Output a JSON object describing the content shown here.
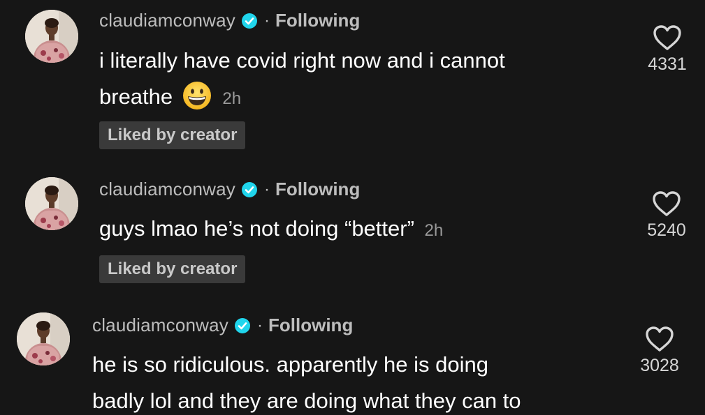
{
  "comments": [
    {
      "username": "claudiamconway",
      "separator": "·",
      "follow_status": "Following",
      "text_line1": "i literally have covid right now and i cannot",
      "text_line2": "breathe",
      "time": "2h",
      "liked_badge": "Liked by creator",
      "like_count": "4331"
    },
    {
      "username": "claudiamconway",
      "separator": "·",
      "follow_status": "Following",
      "text_line1": "guys lmao he’s not doing “better”",
      "time": "2h",
      "liked_badge": "Liked by creator",
      "like_count": "5240"
    },
    {
      "username": "claudiamconway",
      "separator": "·",
      "follow_status": "Following",
      "text_line1": "he is so ridiculous. apparently he is doing",
      "text_line2": "badly lol and they are doing what they can to",
      "like_count": "3028"
    }
  ],
  "icons": {
    "verified": "verified-badge-icon",
    "heart": "heart-outline-icon",
    "emoji": "grinning-face-emoji"
  },
  "colors": {
    "background": "#161616",
    "verified_blue": "#20d5ec",
    "muted_text": "#bdbdbd",
    "badge_bg": "#3a3a3a"
  }
}
